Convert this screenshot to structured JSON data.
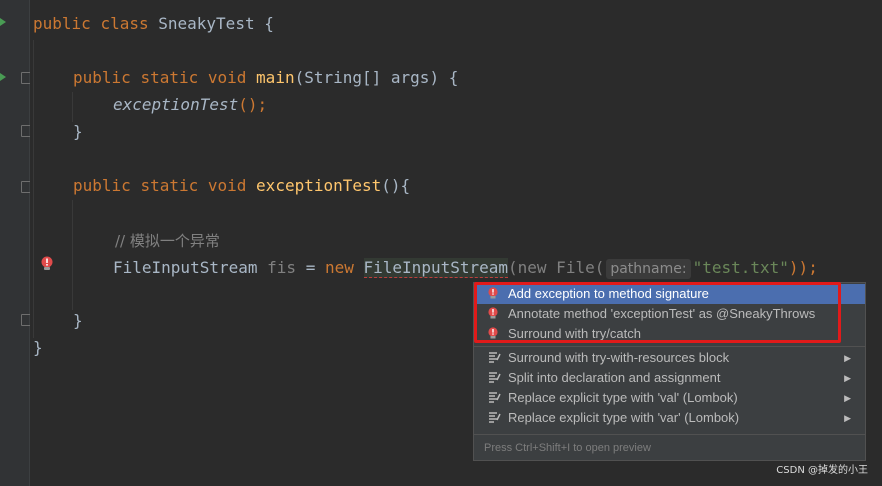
{
  "code": {
    "l1": {
      "kw1": "public",
      "kw2": "class",
      "name": "SneakyTest",
      "brace": "{"
    },
    "l2": {
      "kw1": "public",
      "kw2": "static",
      "kw3": "void",
      "fn": "main",
      "params": "(String[] args) {"
    },
    "l3": {
      "call": "exceptionTest",
      "rest": "();"
    },
    "l4": {
      "brace": "}"
    },
    "l5": {
      "kw1": "public",
      "kw2": "static",
      "kw3": "void",
      "fn": "exceptionTest",
      "rest": "(){"
    },
    "l6": {
      "comment": "// 模拟一个异常"
    },
    "l7": {
      "type": "FileInputStream",
      "var": "fis",
      "eq": "=",
      "kw": "new",
      "ctor": "FileInputStream",
      "inner": "(new File(",
      "hint": "pathname:",
      "str": "\"test.txt\"",
      "end": "));"
    },
    "l8": {
      "brace": "}"
    },
    "l9": {
      "brace": "}"
    }
  },
  "popup": {
    "items": [
      {
        "label": "Add exception to method signature"
      },
      {
        "label": "Annotate method 'exceptionTest' as @SneakyThrows"
      },
      {
        "label": "Surround with try/catch"
      },
      {
        "label": "Surround with try-with-resources block"
      },
      {
        "label": "Split into declaration and assignment"
      },
      {
        "label": "Replace explicit type with 'val' (Lombok)"
      },
      {
        "label": "Replace explicit type with 'var' (Lombok)"
      }
    ],
    "footer": "Press Ctrl+Shift+I to open preview"
  },
  "watermark": "CSDN @掉发的小王",
  "colors": {
    "error": "#e04b4b",
    "selection": "#4b6eaf",
    "highlight_box": "#e11a1a"
  }
}
